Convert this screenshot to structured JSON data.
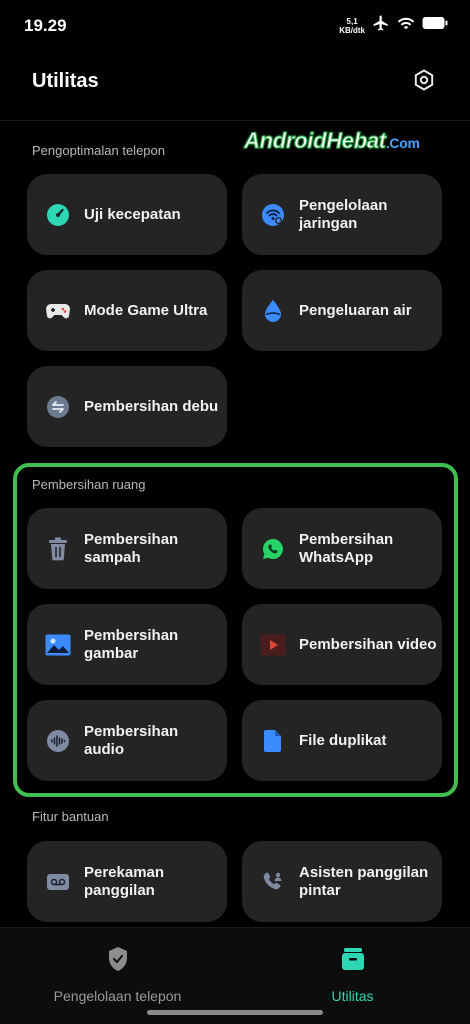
{
  "status": {
    "time": "19.29",
    "net_speed_value": "5,1",
    "net_speed_unit": "KB/dtk"
  },
  "header": {
    "title": "Utilitas"
  },
  "watermark": {
    "main": "AndroidHebat",
    "suffix": ".Com"
  },
  "sections": [
    {
      "label": "Pengoptimalan telepon",
      "items": [
        {
          "label": "Uji kecepatan",
          "icon": "speedometer-icon",
          "color": "#2ed7b4"
        },
        {
          "label": "Pengelolaan jaringan",
          "icon": "wifi-settings-icon",
          "color": "#3b8bff"
        },
        {
          "label": "Mode Game Ultra",
          "icon": "gamepad-icon",
          "color": "#e8e8e8"
        },
        {
          "label": "Pengeluaran air",
          "icon": "water-drop-icon",
          "color": "#3b8bff"
        },
        {
          "label": "Pembersihan debu",
          "icon": "dust-clean-icon",
          "color": "#6c7a91"
        }
      ]
    },
    {
      "label": "Pembersihan ruang",
      "items": [
        {
          "label": "Pembersihan sampah",
          "icon": "trash-icon",
          "color": "#7f8aa3"
        },
        {
          "label": "Pembersihan WhatsApp",
          "icon": "whatsapp-icon",
          "color": "#25d366"
        },
        {
          "label": "Pembersihan gambar",
          "icon": "image-icon",
          "color": "#3b8bff"
        },
        {
          "label": "Pembersihan video",
          "icon": "video-play-icon",
          "color": "#e0453a"
        },
        {
          "label": "Pembersihan audio",
          "icon": "audio-wave-icon",
          "color": "#7f8aa3"
        },
        {
          "label": "File duplikat",
          "icon": "file-icon",
          "color": "#3b8bff"
        }
      ]
    },
    {
      "label": "Fitur bantuan",
      "items": [
        {
          "label": "Perekaman panggilan",
          "icon": "call-record-icon",
          "color": "#7f8aa3"
        },
        {
          "label": "Asisten panggilan pintar",
          "icon": "call-assistant-icon",
          "color": "#7f8aa3"
        }
      ]
    }
  ],
  "bottom_nav": {
    "left_label": "Pengelolaan telepon",
    "right_label": "Utilitas",
    "active_color": "#2ed7b4"
  }
}
